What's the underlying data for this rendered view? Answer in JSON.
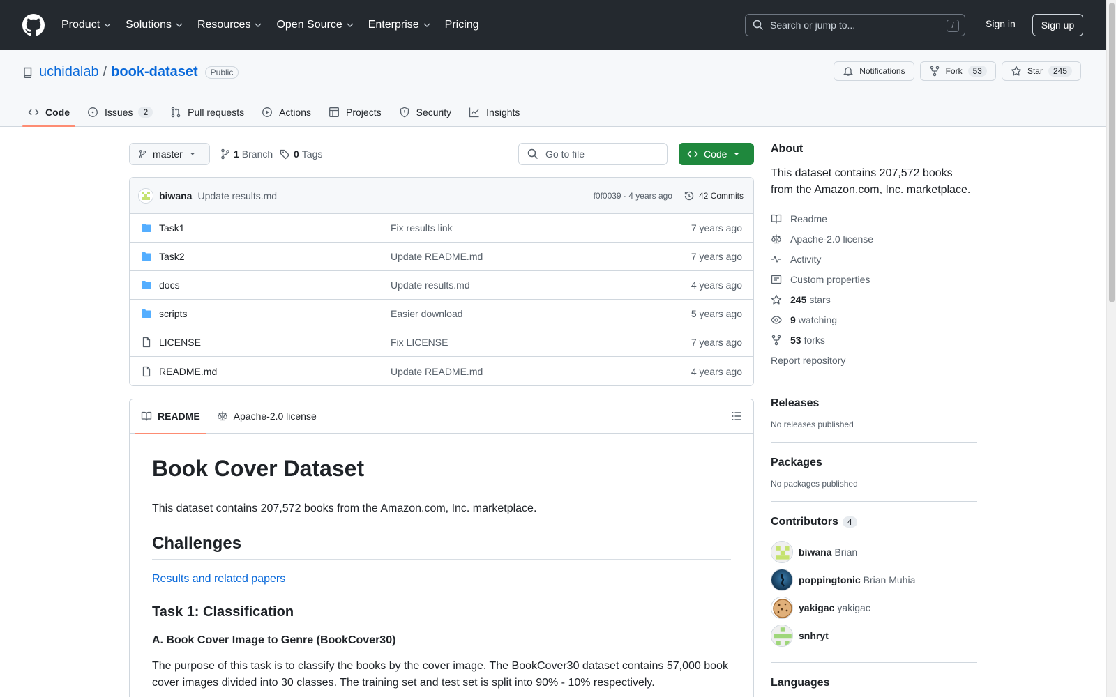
{
  "header": {
    "nav": [
      "Product",
      "Solutions",
      "Resources",
      "Open Source",
      "Enterprise",
      "Pricing"
    ],
    "search_placeholder": "Search or jump to...",
    "search_shortcut": "/",
    "sign_in": "Sign in",
    "sign_up": "Sign up"
  },
  "repo": {
    "owner": "uchidalab",
    "separator": "/",
    "name": "book-dataset",
    "visibility": "Public",
    "notifications_label": "Notifications",
    "fork_label": "Fork",
    "fork_count": "53",
    "star_label": "Star",
    "star_count": "245",
    "tabs": [
      {
        "label": "Code",
        "icon": "code-icon"
      },
      {
        "label": "Issues",
        "count": "2",
        "icon": "issue-icon"
      },
      {
        "label": "Pull requests",
        "icon": "pull-request-icon"
      },
      {
        "label": "Actions",
        "icon": "play-icon"
      },
      {
        "label": "Projects",
        "icon": "table-icon"
      },
      {
        "label": "Security",
        "icon": "shield-icon"
      },
      {
        "label": "Insights",
        "icon": "graph-icon"
      }
    ]
  },
  "toolbar": {
    "branch": "master",
    "branch_count": "1",
    "branch_label": "Branch",
    "tag_count": "0",
    "tag_label": "Tags",
    "go_to_file": "Go to file",
    "code_button": "Code"
  },
  "latest_commit": {
    "author": "biwana",
    "message": "Update results.md",
    "hash_time": "f0f0039 · 4 years ago",
    "commits": "42 Commits"
  },
  "files": [
    {
      "name": "Task1",
      "type": "folder",
      "message": "Fix results link",
      "date": "7 years ago"
    },
    {
      "name": "Task2",
      "type": "folder",
      "message": "Update README.md",
      "date": "7 years ago"
    },
    {
      "name": "docs",
      "type": "folder",
      "message": "Update results.md",
      "date": "4 years ago"
    },
    {
      "name": "scripts",
      "type": "folder",
      "message": "Easier download",
      "date": "5 years ago"
    },
    {
      "name": "LICENSE",
      "type": "file",
      "message": "Fix LICENSE",
      "date": "7 years ago"
    },
    {
      "name": "README.md",
      "type": "file",
      "message": "Update README.md",
      "date": "4 years ago"
    }
  ],
  "readme": {
    "tab_readme": "README",
    "tab_license": "Apache-2.0 license",
    "title": "Book Cover Dataset",
    "intro": "This dataset contains 207,572 books from the Amazon.com, Inc. marketplace.",
    "challenges": "Challenges",
    "results_link": "Results and related papers",
    "task1": "Task 1: Classification",
    "task1a": "A. Book Cover Image to Genre (BookCover30)",
    "task1_text": "The purpose of this task is to classify the books by the cover image. The BookCover30 dataset contains 57,000 book cover images divided into 30 classes. The training set and test set is split into 90% - 10% respectively."
  },
  "sidebar": {
    "about_title": "About",
    "about_text": "This dataset contains 207,572 books from the Amazon.com, Inc. marketplace.",
    "links": [
      {
        "label": "Readme",
        "icon": "book-icon"
      },
      {
        "label": "Apache-2.0 license",
        "icon": "law-icon"
      },
      {
        "label": "Activity",
        "icon": "pulse-icon"
      },
      {
        "label": "Custom properties",
        "icon": "note-icon"
      }
    ],
    "stars_count": "245",
    "stars_label": "stars",
    "watching_count": "9",
    "watching_label": "watching",
    "forks_count": "53",
    "forks_label": "forks",
    "report": "Report repository",
    "releases_title": "Releases",
    "releases_text": "No releases published",
    "packages_title": "Packages",
    "packages_text": "No packages published",
    "contributors_title": "Contributors",
    "contributors_count": "4",
    "contributors": [
      {
        "login": "biwana",
        "name": "Brian"
      },
      {
        "login": "poppingtonic",
        "name": "Brian Muhia"
      },
      {
        "login": "yakigac",
        "name": "yakigac"
      },
      {
        "login": "snhryt",
        "name": ""
      }
    ],
    "languages_title": "Languages"
  },
  "colors": {
    "header_bg": "#24292f",
    "link": "#0969da",
    "primary_button": "#1f883d",
    "folder": "#54aeff",
    "active_tab_underline": "#fd8c73"
  }
}
